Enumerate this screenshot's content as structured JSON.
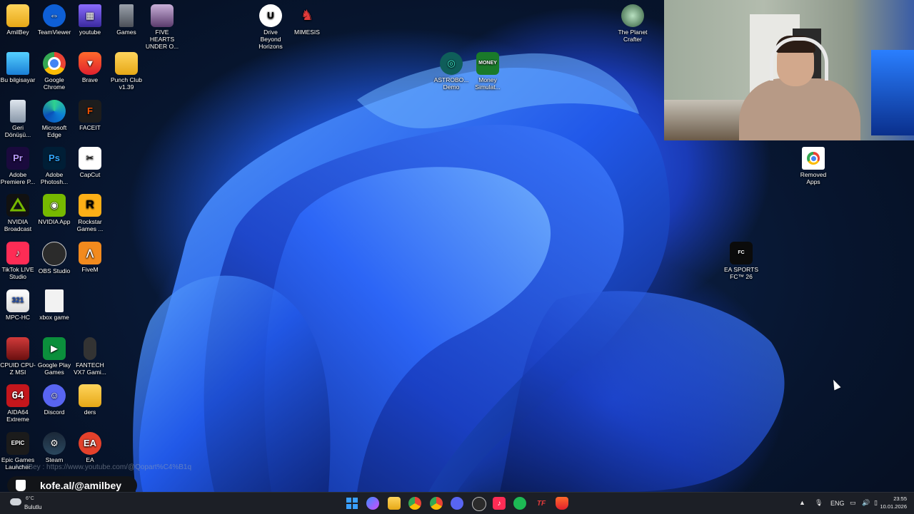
{
  "desktop_icons": {
    "amilbey": "AmilBey",
    "teamviewer": "TeamViewer",
    "youtube": "youtube",
    "games": "Games",
    "five_hearts": "FIVE HEARTS UNDER O...",
    "drive_beyond": "Drive Beyond Horizons",
    "mimesis": "MIMESIS",
    "planet_crafter": "The Planet Crafter",
    "bu_bilgisayar": "Bu bilgisayar",
    "google_chrome": "Google Chrome",
    "brave": "Brave",
    "punch_club": "Punch Club v1.39",
    "astrobot": "ASTROBO... Demo",
    "money_sim": "Money Simulat...",
    "geri_donusum": "Geri Dönüşü...",
    "microsoft_edge": "Microsoft Edge",
    "faceit": "FACEIT",
    "premiere": "Adobe Premiere P...",
    "photoshop": "Adobe Photosh...",
    "capcut": "CapCut",
    "removed_apps": "Removed Apps",
    "nvidia_broadcast": "NVIDIA Broadcast",
    "nvidia_app": "NVIDIA App",
    "rockstar": "Rockstar Games ...",
    "tiktok_live": "TikTok LIVE Studio",
    "obs": "OBS Studio",
    "fivem": "FiveM",
    "ea_fc": "EA SPORTS FC™ 26",
    "mpc_hc": "MPC-HC",
    "xbox_game": "xbox game",
    "cpuid": "CPUID CPU-Z MSI",
    "google_play_games": "Google Play Games",
    "fantech": "FANTECH VX7 Gami...",
    "aida64": "AIDA64 Extreme",
    "discord": "Discord",
    "ders": "ders",
    "epic": "Epic Games Launcher",
    "steam": "Steam",
    "ea": "EA"
  },
  "glyphs": {
    "premiere": "Pr",
    "photoshop": "Ps",
    "aida64": "64",
    "mpc_hc": "321",
    "epic": "EPIC",
    "ea": "EA",
    "rockstar": "R",
    "faceit": "F",
    "money_sim": "MONEY"
  },
  "overlay": {
    "channel_url": "AmilBey : https://www.youtube.com/@Qopart%C4%B1q",
    "kofe_link": "kofe.al/@amilbey"
  },
  "weather": {
    "temperature": "6°C",
    "condition": "Bulutlu"
  },
  "tray": {
    "language": "ENG",
    "time": "23:55",
    "date": "10.01.2026"
  },
  "colors": {
    "accent_blue": "#1f58e6",
    "taskbar_bg": "#1c1f26"
  }
}
